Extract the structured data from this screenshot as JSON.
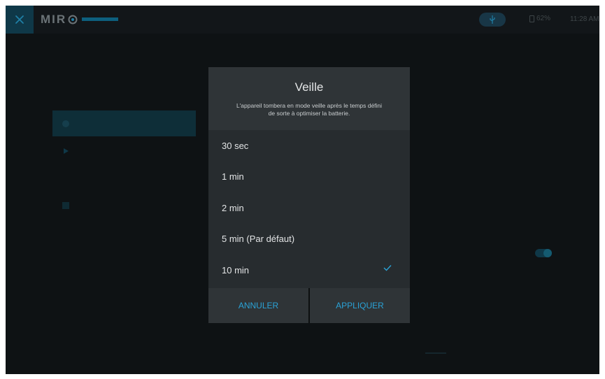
{
  "topbar": {
    "logo_text": "MIR",
    "battery_text": "62%",
    "time": "11:28 AM"
  },
  "modal": {
    "title": "Veille",
    "description_line1": "L'appareil tombera en mode veille après le temps défini",
    "description_line2": "de sorte à optimiser la batterie.",
    "options": [
      {
        "label": "30 sec",
        "selected": false
      },
      {
        "label": "1 min",
        "selected": false
      },
      {
        "label": "2 min",
        "selected": false
      },
      {
        "label": "5 min (Par défaut)",
        "selected": false
      },
      {
        "label": "10 min",
        "selected": true
      }
    ],
    "cancel_label": "ANNULER",
    "apply_label": "APPLIQUER"
  },
  "colors": {
    "accent": "#2aa2d6",
    "background": "#0e1214",
    "modal": "#272c2f"
  }
}
